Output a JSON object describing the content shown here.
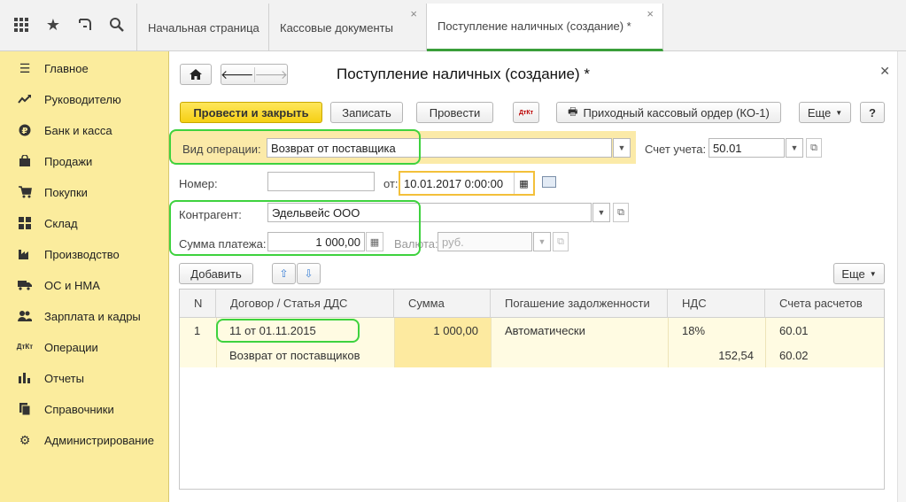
{
  "topbar": {
    "icons": [
      "apps-grid-icon",
      "star-icon",
      "history-icon",
      "search-icon"
    ],
    "tabs": [
      {
        "label": "Начальная страница",
        "closable": false
      },
      {
        "label": "Кассовые документы",
        "closable": true
      },
      {
        "label": "Поступление наличных (создание) *",
        "closable": true,
        "active": true
      }
    ],
    "close_glyph": "×"
  },
  "sidebar": {
    "items": [
      {
        "label": "Главное",
        "icon": "menu-lines-icon"
      },
      {
        "label": "Руководителю",
        "icon": "trend-up-icon"
      },
      {
        "label": "Банк и касса",
        "icon": "ruble-coin-icon"
      },
      {
        "label": "Продажи",
        "icon": "shopping-bag-icon"
      },
      {
        "label": "Покупки",
        "icon": "cart-icon"
      },
      {
        "label": "Склад",
        "icon": "warehouse-icon"
      },
      {
        "label": "Производство",
        "icon": "factory-icon"
      },
      {
        "label": "ОС и НМА",
        "icon": "truck-icon"
      },
      {
        "label": "Зарплата и кадры",
        "icon": "people-icon"
      },
      {
        "label": "Операции",
        "icon": "debit-credit-icon",
        "glyph": "ДтКт"
      },
      {
        "label": "Отчеты",
        "icon": "bar-chart-icon"
      },
      {
        "label": "Справочники",
        "icon": "books-icon"
      },
      {
        "label": "Администрирование",
        "icon": "gear-icon"
      }
    ]
  },
  "doc": {
    "title": "Поступление наличных (создание) *",
    "buttons": {
      "post_close": "Провести и закрыть",
      "save": "Записать",
      "post": "Провести",
      "dtkt_glyph": "ДтКт",
      "ko1": "Приходный кассовый ордер (КО-1)",
      "more": "Еще",
      "help": "?"
    },
    "fields": {
      "op_type_label": "Вид операции:",
      "op_type_value": "Возврат от поставщика",
      "account_label": "Счет учета:",
      "account_value": "50.01",
      "number_label": "Номер:",
      "number_value": "",
      "date_label": "от:",
      "date_value": "10.01.2017  0:00:00",
      "counterparty_label": "Контрагент:",
      "counterparty_value": "Эдельвейс ООО",
      "amount_label": "Сумма платежа:",
      "amount_value": "1 000,00",
      "currency_label": "Валюта:",
      "currency_value": "руб."
    },
    "table_toolbar": {
      "add": "Добавить",
      "more": "Еще"
    },
    "table": {
      "headers": [
        "N",
        "Договор / Статья ДДС",
        "Сумма",
        "Погашение задолженности",
        "НДС",
        "Счета расчетов"
      ],
      "rows": [
        {
          "n": "1",
          "contract": "11 от 01.11.2015",
          "dds_article": "Возврат от поставщиков",
          "amount": "1 000,00",
          "repayment": "Автоматически",
          "vat_rate": "18%",
          "vat_amount": "152,54",
          "account1": "60.01",
          "account2": "60.02"
        }
      ]
    }
  }
}
